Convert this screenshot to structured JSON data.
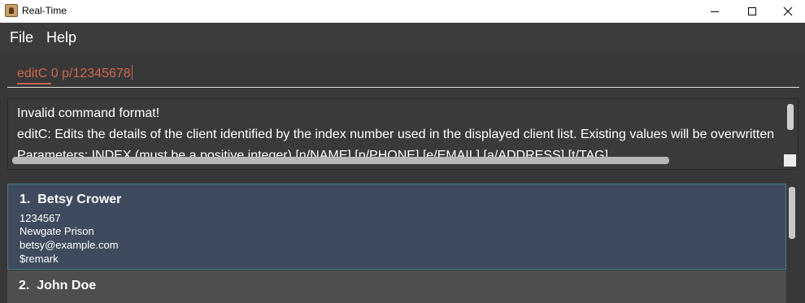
{
  "window": {
    "title": "Real-Time"
  },
  "menu": {
    "file": "File",
    "help": "Help"
  },
  "command": {
    "value": "editC 0 p/12345678"
  },
  "result": {
    "lines": [
      "Invalid command format!",
      "editC: Edits the details of the client identified by the index number used in the displayed client list. Existing values will be overwritten",
      "Parameters: INDEX (must be a positive integer) [n/NAME] [p/PHONE] [e/EMAIL] [a/ADDRESS] [t/TAG]..."
    ]
  },
  "clients": [
    {
      "index": "1.",
      "name": "Betsy Crower",
      "phone": "1234567",
      "address": "Newgate Prison",
      "email": "betsy@example.com",
      "remark": "$remark"
    },
    {
      "index": "2.",
      "name": "John Doe"
    }
  ],
  "colors": {
    "window_bg": "#383838",
    "command_text": "#d06651",
    "selected_card": "#3e4b5e",
    "card_border": "#4a7a84",
    "second_card": "#4e4e4e"
  },
  "icons": {
    "app": "app-icon",
    "minimize": "minimize-icon",
    "maximize": "maximize-icon",
    "close": "close-icon"
  }
}
